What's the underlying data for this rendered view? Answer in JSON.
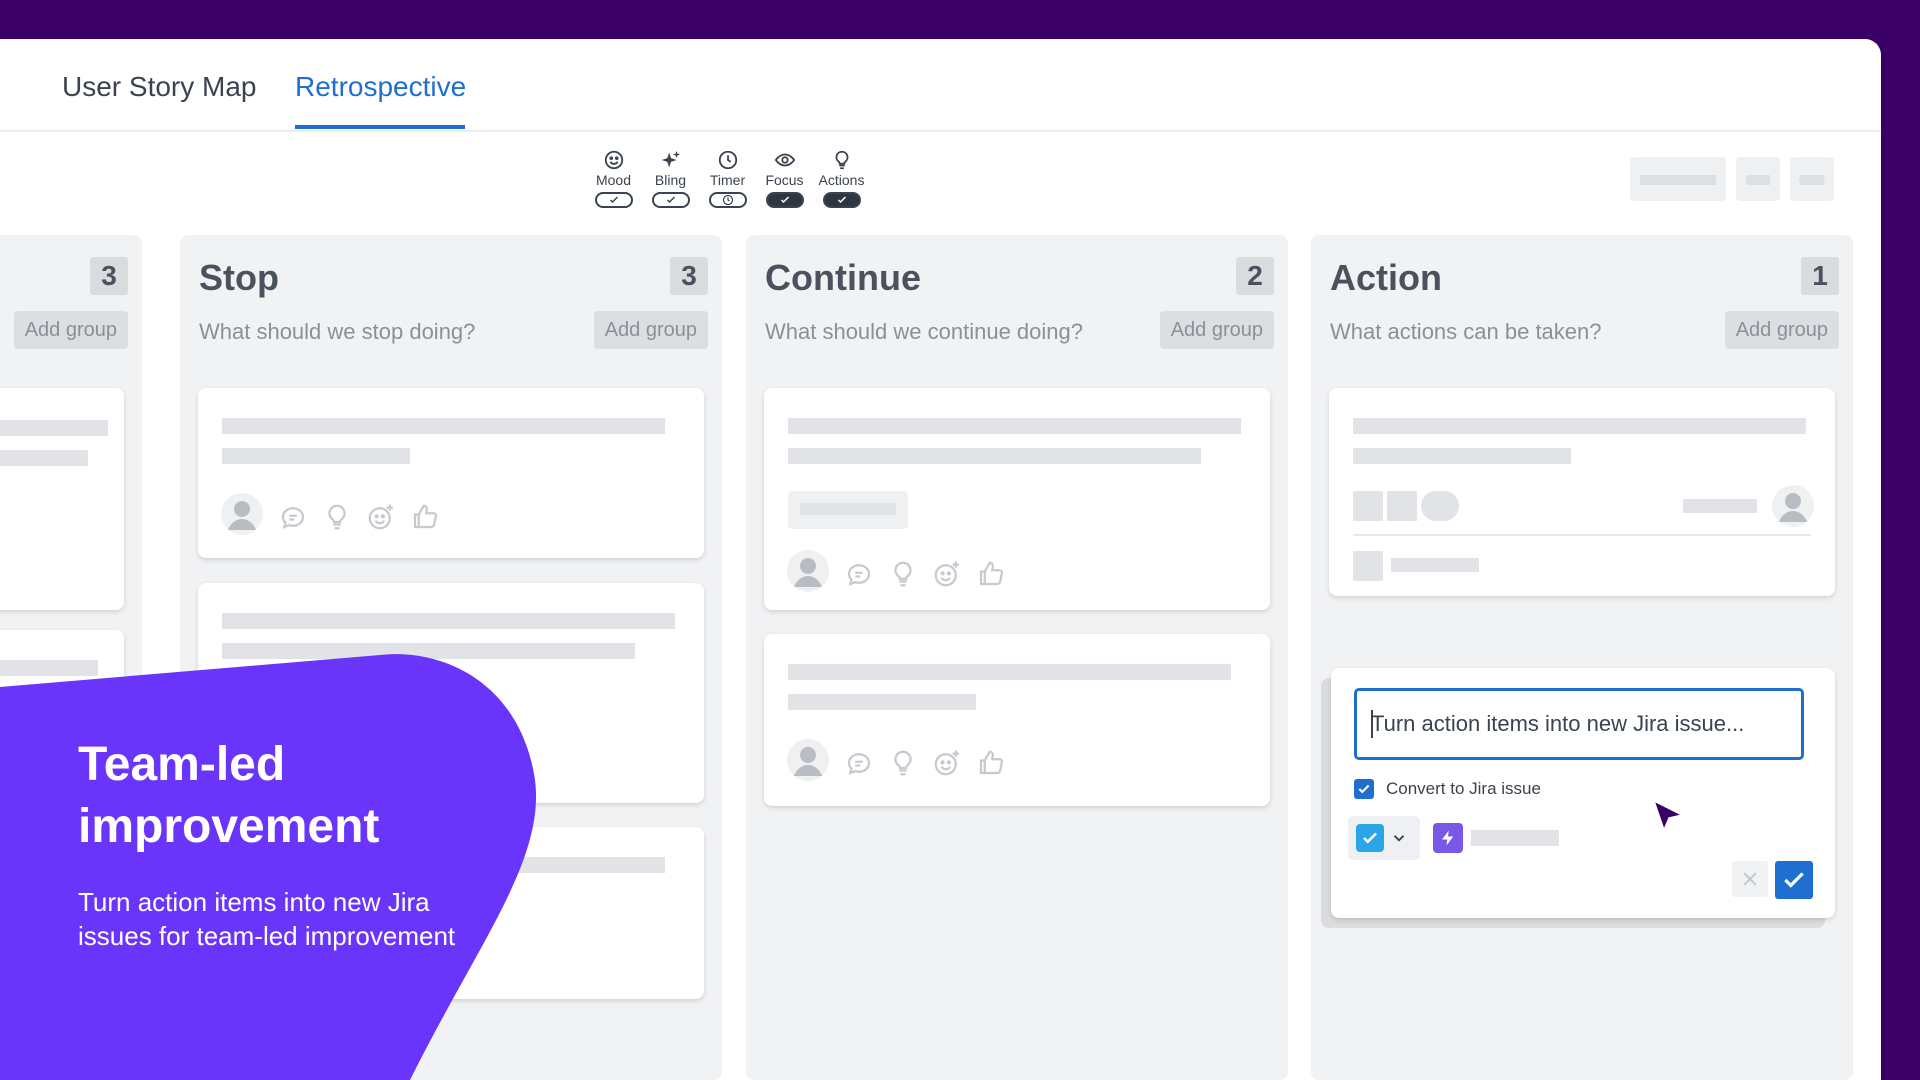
{
  "tabs": [
    {
      "label": "User Story Map"
    },
    {
      "label": "Retrospective",
      "active": true
    }
  ],
  "toolbar": {
    "items": [
      {
        "label": "Mood",
        "icon": "smiley-icon",
        "enabled": false
      },
      {
        "label": "Bling",
        "icon": "sparkle-icon",
        "enabled": false
      },
      {
        "label": "Timer",
        "icon": "clock-icon",
        "enabled": false
      },
      {
        "label": "Focus",
        "icon": "eye-icon",
        "enabled": true
      },
      {
        "label": "Actions",
        "icon": "lightbulb-icon",
        "enabled": true
      }
    ]
  },
  "columns": [
    {
      "title": "",
      "count": "3",
      "subtitle": "",
      "add_group": "Add group"
    },
    {
      "title": "Stop",
      "count": "3",
      "subtitle": "What should we stop doing?",
      "add_group": "Add group"
    },
    {
      "title": "Continue",
      "count": "2",
      "subtitle": "What should we continue doing?",
      "add_group": "Add group"
    },
    {
      "title": "Action",
      "count": "1",
      "subtitle": "What actions can be taken?",
      "add_group": "Add group"
    }
  ],
  "action_editor": {
    "input_value": "Turn action items into new Jira issue...",
    "convert_label": "Convert to Jira issue",
    "convert_checked": true
  },
  "promo": {
    "title": "Team-led improvement",
    "body": "Turn action items into new Jira issues for team-led improvement"
  },
  "colors": {
    "background": "#3a0066",
    "accent": "#1f6fd1",
    "promo": "#6a35fb",
    "cursor": "#3a0066"
  }
}
